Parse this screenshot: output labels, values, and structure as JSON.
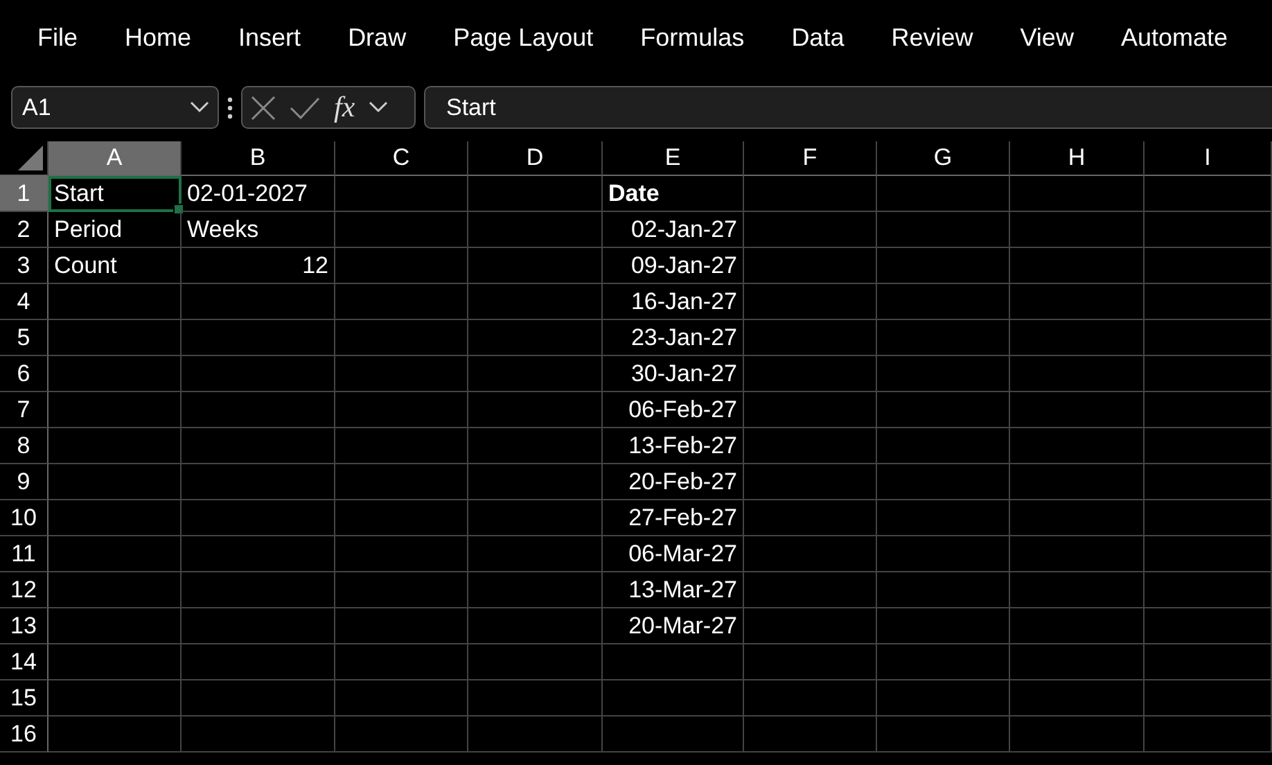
{
  "menu": [
    "File",
    "Home",
    "Insert",
    "Draw",
    "Page Layout",
    "Formulas",
    "Data",
    "Review",
    "View",
    "Automate"
  ],
  "formula_bar": {
    "name_box": "A1",
    "fx": "fx",
    "formula": "Start"
  },
  "columns": [
    {
      "label": "A",
      "selected": true
    },
    {
      "label": "B",
      "selected": false
    },
    {
      "label": "C",
      "selected": false
    },
    {
      "label": "D",
      "selected": false
    },
    {
      "label": "E",
      "selected": false
    },
    {
      "label": "F",
      "selected": false
    },
    {
      "label": "G",
      "selected": false
    },
    {
      "label": "H",
      "selected": false
    },
    {
      "label": "I",
      "selected": false
    }
  ],
  "rows": [
    {
      "label": "1",
      "selected": true,
      "cells": [
        {
          "text": "Start",
          "kind": "text",
          "selected": true
        },
        {
          "text": "02-01-2027",
          "kind": "text",
          "selected": false
        },
        null,
        null,
        {
          "text": "Date",
          "kind": "text",
          "bold": true,
          "selected": false
        },
        null,
        null,
        null,
        null
      ]
    },
    {
      "label": "2",
      "selected": false,
      "cells": [
        {
          "text": "Period",
          "kind": "text",
          "selected": false
        },
        {
          "text": "Weeks",
          "kind": "text",
          "selected": false
        },
        null,
        null,
        {
          "text": "02-Jan-27",
          "kind": "number",
          "selected": false
        },
        null,
        null,
        null,
        null
      ]
    },
    {
      "label": "3",
      "selected": false,
      "cells": [
        {
          "text": "Count",
          "kind": "text",
          "selected": false
        },
        {
          "text": "12",
          "kind": "number",
          "selected": false
        },
        null,
        null,
        {
          "text": "09-Jan-27",
          "kind": "number",
          "selected": false
        },
        null,
        null,
        null,
        null
      ]
    },
    {
      "label": "4",
      "selected": false,
      "cells": [
        null,
        null,
        null,
        null,
        {
          "text": "16-Jan-27",
          "kind": "number",
          "selected": false
        },
        null,
        null,
        null,
        null
      ]
    },
    {
      "label": "5",
      "selected": false,
      "cells": [
        null,
        null,
        null,
        null,
        {
          "text": "23-Jan-27",
          "kind": "number",
          "selected": false
        },
        null,
        null,
        null,
        null
      ]
    },
    {
      "label": "6",
      "selected": false,
      "cells": [
        null,
        null,
        null,
        null,
        {
          "text": "30-Jan-27",
          "kind": "number",
          "selected": false
        },
        null,
        null,
        null,
        null
      ]
    },
    {
      "label": "7",
      "selected": false,
      "cells": [
        null,
        null,
        null,
        null,
        {
          "text": "06-Feb-27",
          "kind": "number",
          "selected": false
        },
        null,
        null,
        null,
        null
      ]
    },
    {
      "label": "8",
      "selected": false,
      "cells": [
        null,
        null,
        null,
        null,
        {
          "text": "13-Feb-27",
          "kind": "number",
          "selected": false
        },
        null,
        null,
        null,
        null
      ]
    },
    {
      "label": "9",
      "selected": false,
      "cells": [
        null,
        null,
        null,
        null,
        {
          "text": "20-Feb-27",
          "kind": "number",
          "selected": false
        },
        null,
        null,
        null,
        null
      ]
    },
    {
      "label": "10",
      "selected": false,
      "cells": [
        null,
        null,
        null,
        null,
        {
          "text": "27-Feb-27",
          "kind": "number",
          "selected": false
        },
        null,
        null,
        null,
        null
      ]
    },
    {
      "label": "11",
      "selected": false,
      "cells": [
        null,
        null,
        null,
        null,
        {
          "text": "06-Mar-27",
          "kind": "number",
          "selected": false
        },
        null,
        null,
        null,
        null
      ]
    },
    {
      "label": "12",
      "selected": false,
      "cells": [
        null,
        null,
        null,
        null,
        {
          "text": "13-Mar-27",
          "kind": "number",
          "selected": false
        },
        null,
        null,
        null,
        null
      ]
    },
    {
      "label": "13",
      "selected": false,
      "cells": [
        null,
        null,
        null,
        null,
        {
          "text": "20-Mar-27",
          "kind": "number",
          "selected": false
        },
        null,
        null,
        null,
        null
      ]
    },
    {
      "label": "14",
      "selected": false,
      "cells": [
        null,
        null,
        null,
        null,
        null,
        null,
        null,
        null,
        null
      ]
    },
    {
      "label": "15",
      "selected": false,
      "cells": [
        null,
        null,
        null,
        null,
        null,
        null,
        null,
        null,
        null
      ]
    },
    {
      "label": "16",
      "selected": false,
      "cells": [
        null,
        null,
        null,
        null,
        null,
        null,
        null,
        null,
        null
      ]
    }
  ]
}
